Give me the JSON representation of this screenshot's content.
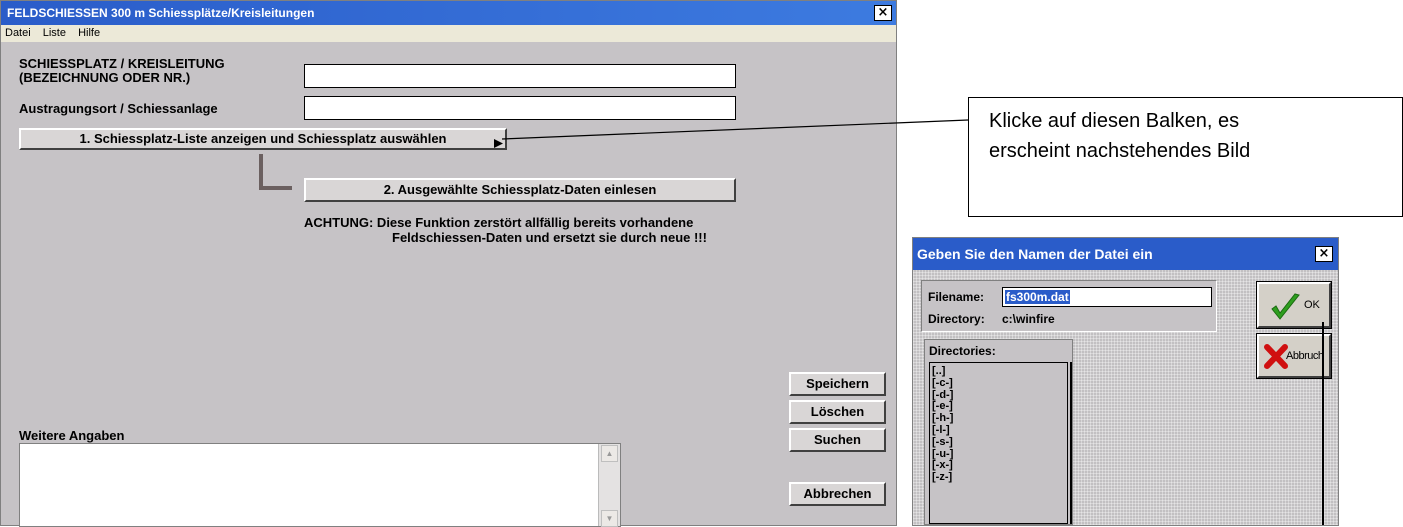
{
  "main_window": {
    "title": "FELDSCHIESSEN  300 m   Schiessplätze/Kreisleitungen",
    "close_glyph": "×",
    "menu": [
      "Datei",
      "Liste",
      "Hilfe"
    ],
    "fields": {
      "schiessplatz_label_1": "SCHIESSPLATZ / KREISLEITUNG",
      "schiessplatz_label_2": "(BEZEICHNUNG ODER NR.)",
      "schiessplatz_value": "",
      "austragungsort_label": "Austragungsort / Schiessanlage",
      "austragungsort_value": ""
    },
    "buttons": {
      "liste_anzeigen": "1.  Schiessplatz-Liste anzeigen und Schiessplatz auswählen",
      "daten_einlesen": "2.   Ausgewählte Schiessplatz-Daten einlesen",
      "speichern": "Speichern",
      "loeschen": "Löschen",
      "suchen": "Suchen",
      "abbrechen": "Abbrechen"
    },
    "warning_line_1": "ACHTUNG: Diese Funktion zerstört allfällig bereits vorhandene",
    "warning_line_2": "Feldschiessen-Daten und ersetzt sie durch neue !!!",
    "weitere_angaben_label": "Weitere Angaben",
    "weitere_angaben_value": ""
  },
  "callout": {
    "line_1": "Klicke auf diesen Balken, es",
    "line_2": "erscheint nachstehendes Bild"
  },
  "dialog": {
    "title": "Geben Sie den Namen der Datei ein",
    "close_glyph": "×",
    "filename_label": "Filename:",
    "filename_value": "fs300m.dat",
    "directory_label": "Directory:",
    "directory_value": "c:\\winfire",
    "directories_label": "Directories:",
    "directories": [
      "[..]",
      "[-c-]",
      "[-d-]",
      "[-e-]",
      "[-h-]",
      "[-l-]",
      "[-s-]",
      "[-u-]",
      "[-x-]",
      "[-z-]"
    ],
    "ok_label": "OK",
    "abbruch_label": "Abbruch"
  },
  "colors": {
    "titlebar": "#2a5cc9",
    "window_bg": "#c6c3c6",
    "ok_check": "#2e9e1e",
    "abbruch_x": "#d01010"
  }
}
